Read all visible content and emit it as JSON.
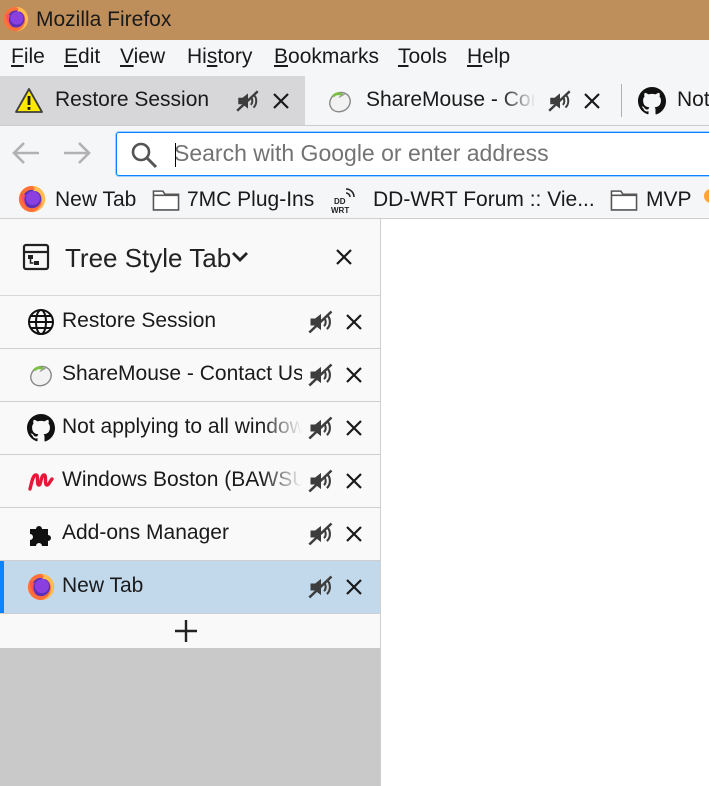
{
  "window": {
    "title": "Mozilla Firefox",
    "colors": {
      "titlebar": "#bf8f5b",
      "accent": "#0a84ff",
      "active_tab_row": "#c2d9ec"
    }
  },
  "menubar": {
    "items": [
      {
        "pre": "",
        "key": "F",
        "post": "ile"
      },
      {
        "pre": "",
        "key": "E",
        "post": "dit"
      },
      {
        "pre": "",
        "key": "V",
        "post": "iew"
      },
      {
        "pre": "Hi",
        "key": "s",
        "post": "tory"
      },
      {
        "pre": "",
        "key": "B",
        "post": "ookmarks"
      },
      {
        "pre": "",
        "key": "T",
        "post": "ools"
      },
      {
        "pre": "",
        "key": "H",
        "post": "elp"
      }
    ]
  },
  "tabs": [
    {
      "label": "Restore Session",
      "icon": "warning-icon",
      "selected": true
    },
    {
      "label": "ShareMouse - Contact Us",
      "icon": "sharemouse-icon",
      "selected": false
    },
    {
      "label": "Not applying to all windows",
      "icon": "github-icon",
      "selected": false
    }
  ],
  "navbar": {
    "search_placeholder": "Search with Google or enter address",
    "search_value": ""
  },
  "bookmarks": [
    {
      "label": "New Tab",
      "icon": "firefox-icon"
    },
    {
      "label": "7MC Plug-Ins",
      "icon": "folder-icon"
    },
    {
      "label": "DD-WRT Forum :: Vie...",
      "icon": "dd-wrt-icon"
    },
    {
      "label": "MVP",
      "icon": "folder-icon"
    }
  ],
  "sidebar": {
    "title": "Tree Style Tab",
    "tabs": [
      {
        "label": "Restore Session",
        "icon": "globe-icon",
        "active": false
      },
      {
        "label": "ShareMouse - Contact Us",
        "icon": "sharemouse-icon",
        "active": false
      },
      {
        "label": "Not applying to all windows",
        "icon": "github-icon",
        "active": false
      },
      {
        "label": "Windows Boston (BAWSUG)",
        "icon": "meetup-icon",
        "active": false
      },
      {
        "label": "Add-ons Manager",
        "icon": "puzzle-icon",
        "active": false
      },
      {
        "label": "New Tab",
        "icon": "firefox-icon",
        "active": true
      }
    ]
  }
}
